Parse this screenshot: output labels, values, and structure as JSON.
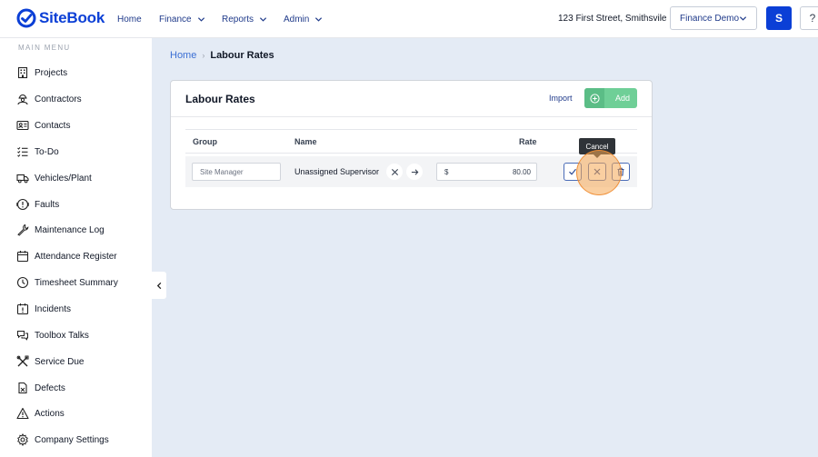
{
  "app": {
    "name": "SiteBook"
  },
  "topnav": {
    "home": "Home",
    "finance": "Finance",
    "reports": "Reports",
    "admin": "Admin",
    "address": "123 First Street, Smithsvile",
    "company": "Finance Demo",
    "user_initial": "S",
    "help": "?"
  },
  "sidebar": {
    "title": "MAIN MENU",
    "items": [
      {
        "label": "Projects",
        "icon": "building-icon"
      },
      {
        "label": "Contractors",
        "icon": "worker-icon"
      },
      {
        "label": "Contacts",
        "icon": "contact-card-icon"
      },
      {
        "label": "To-Do",
        "icon": "checklist-icon"
      },
      {
        "label": "Vehicles/Plant",
        "icon": "truck-icon"
      },
      {
        "label": "Faults",
        "icon": "fault-icon"
      },
      {
        "label": "Maintenance Log",
        "icon": "wrench-icon"
      },
      {
        "label": "Attendance Register",
        "icon": "calendar-icon"
      },
      {
        "label": "Timesheet Summary",
        "icon": "clock-icon"
      },
      {
        "label": "Incidents",
        "icon": "incident-icon"
      },
      {
        "label": "Toolbox Talks",
        "icon": "chat-icon"
      },
      {
        "label": "Service Due",
        "icon": "tools-icon"
      },
      {
        "label": "Defects",
        "icon": "document-icon"
      },
      {
        "label": "Actions",
        "icon": "warning-icon"
      },
      {
        "label": "Company Settings",
        "icon": "gear-icon"
      }
    ]
  },
  "breadcrumb": {
    "home": "Home",
    "separator": "›",
    "current": "Labour Rates"
  },
  "card": {
    "title": "Labour Rates",
    "import_label": "Import",
    "add_label": "Add",
    "columns": {
      "group": "Group",
      "name": "Name",
      "rate": "Rate"
    },
    "row": {
      "group_value": "Site Manager",
      "name_value": "Unassigned Supervisor",
      "currency": "$",
      "rate_value": "80.00"
    }
  },
  "tooltip": {
    "text": "Cancel"
  },
  "colors": {
    "brand": "#0b3fd6",
    "add_button": "#6fcf97",
    "background": "#e4ebf5"
  }
}
